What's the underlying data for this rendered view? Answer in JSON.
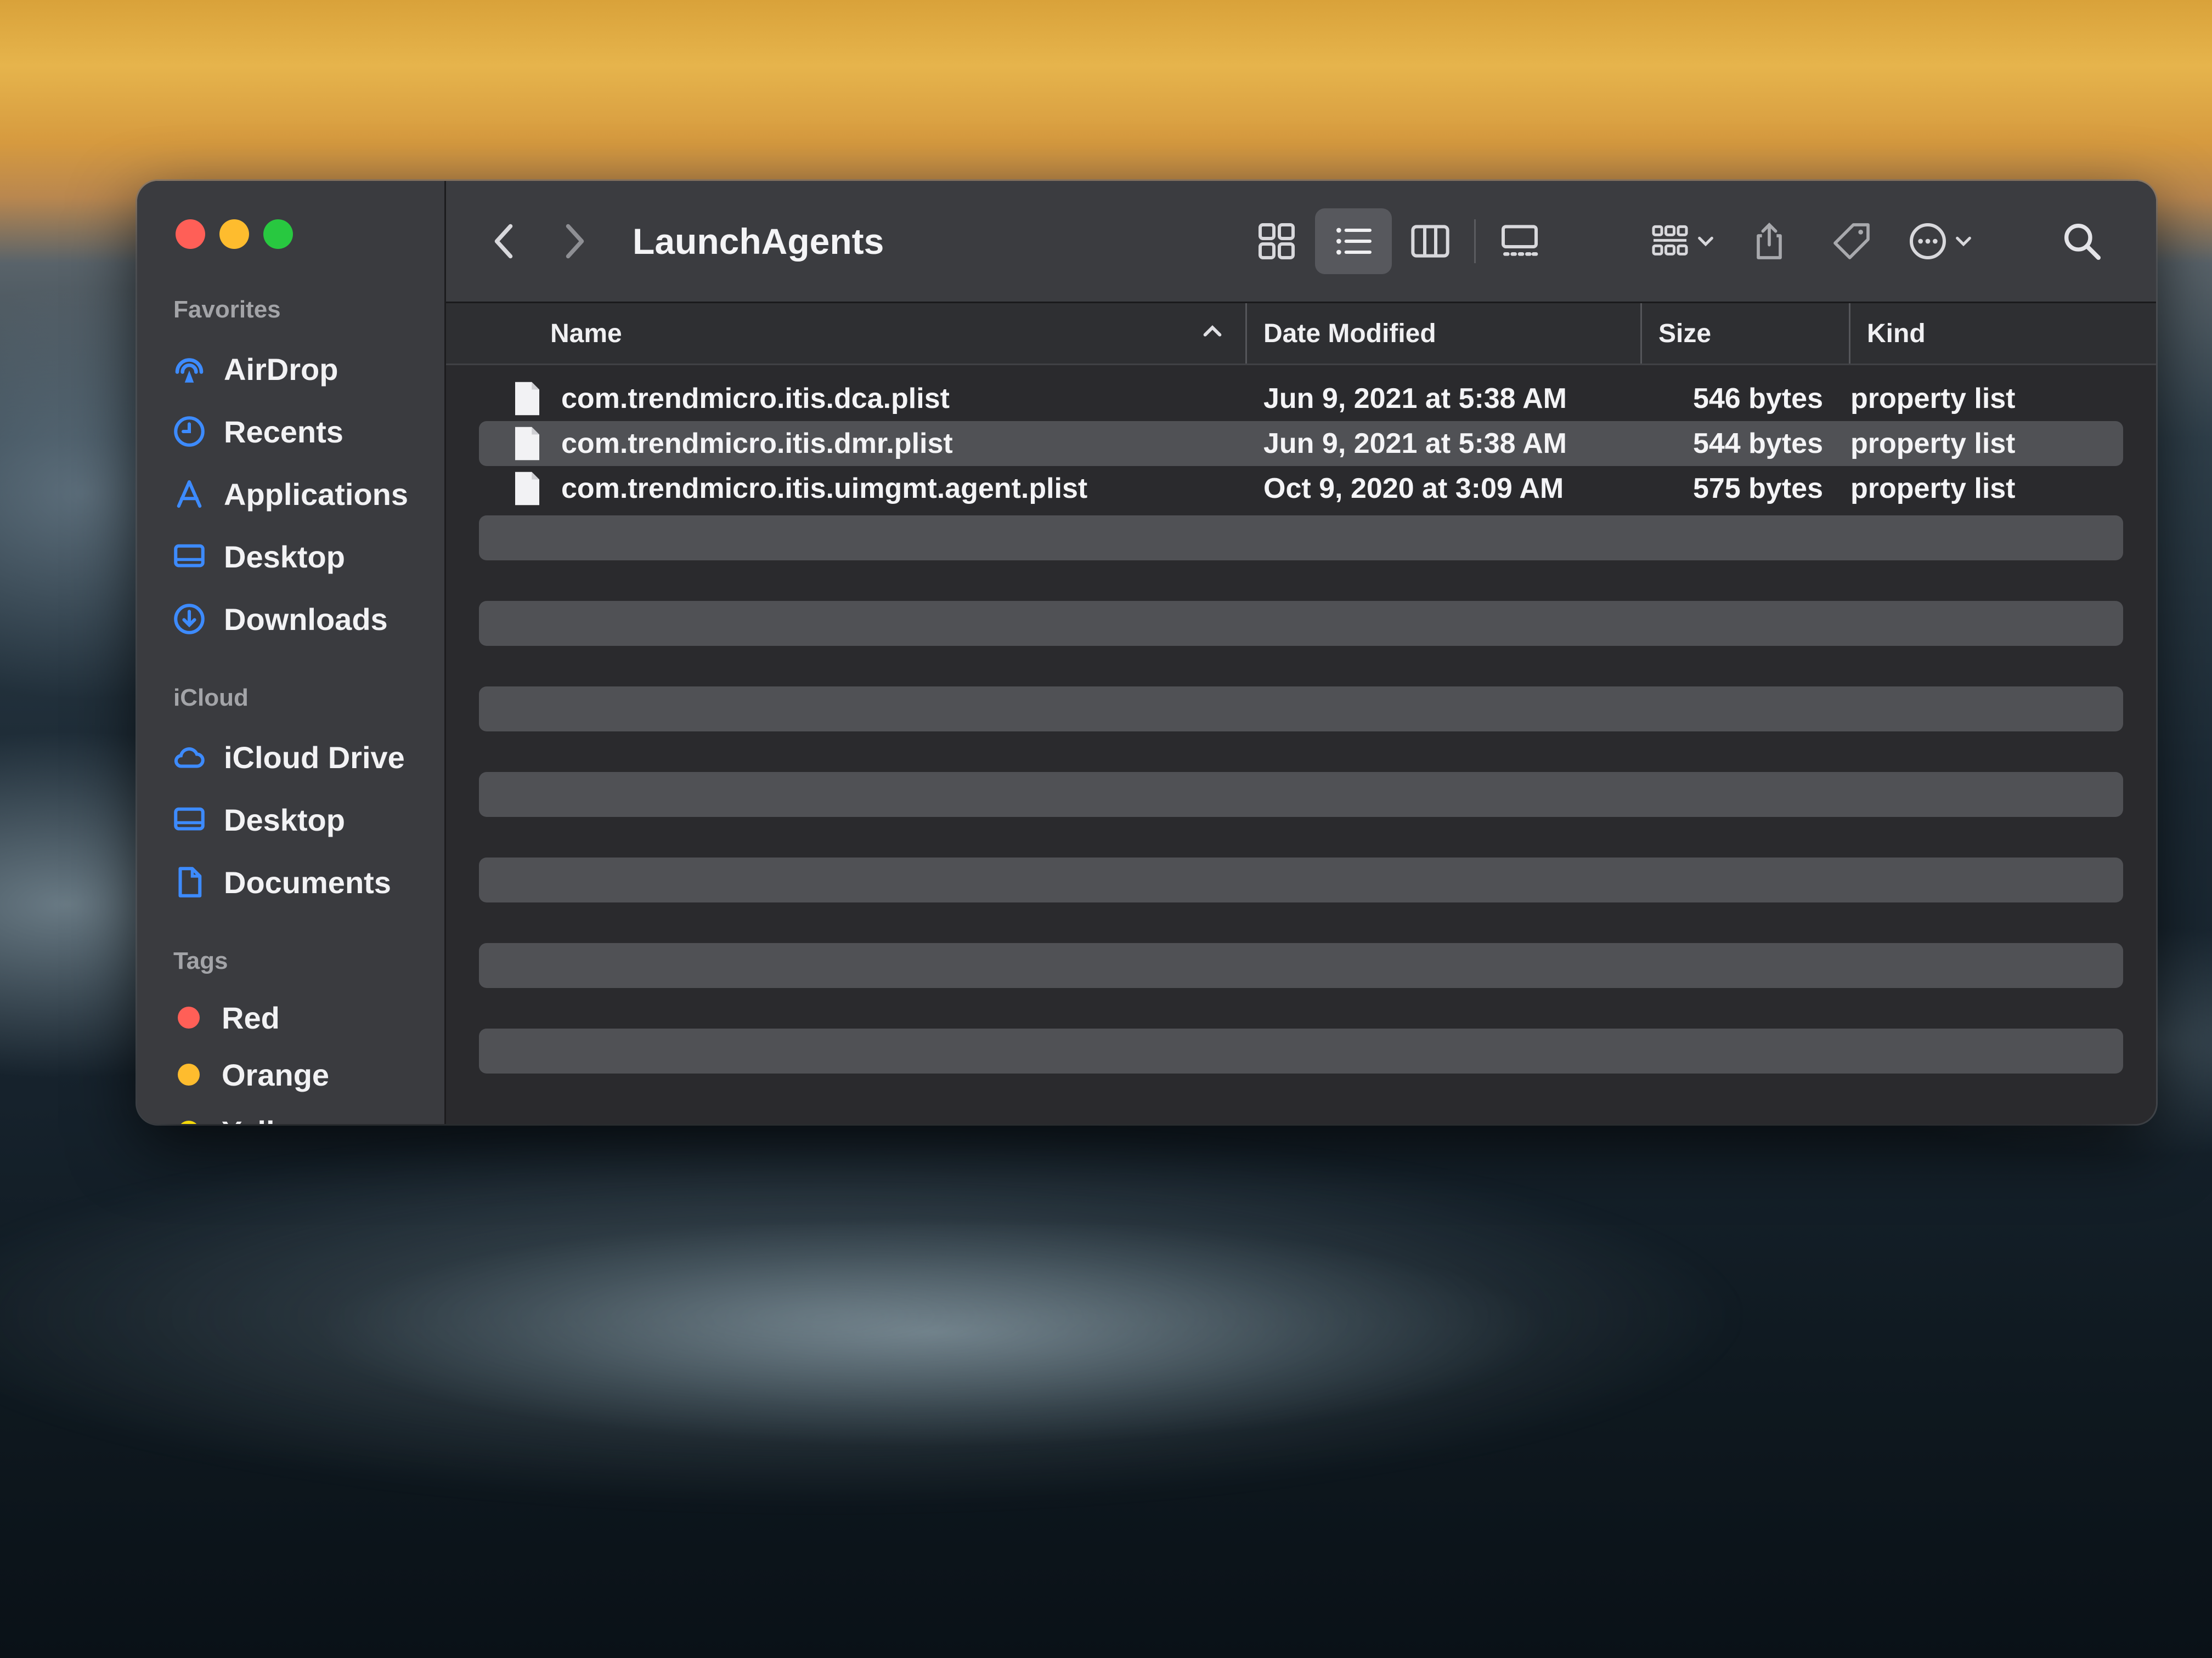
{
  "window": {
    "title": "LaunchAgents"
  },
  "sidebar": {
    "sections": [
      {
        "label": "Favorites",
        "items": [
          {
            "label": "AirDrop",
            "icon": "airdrop-icon"
          },
          {
            "label": "Recents",
            "icon": "clock-icon"
          },
          {
            "label": "Applications",
            "icon": "applications-icon"
          },
          {
            "label": "Desktop",
            "icon": "desktop-icon"
          },
          {
            "label": "Downloads",
            "icon": "download-icon"
          }
        ]
      },
      {
        "label": "iCloud",
        "items": [
          {
            "label": "iCloud Drive",
            "icon": "cloud-icon"
          },
          {
            "label": "Desktop",
            "icon": "desktop-icon"
          },
          {
            "label": "Documents",
            "icon": "document-icon"
          }
        ]
      },
      {
        "label": "Tags",
        "items": [
          {
            "label": "Red",
            "color": "#ff5f57"
          },
          {
            "label": "Orange",
            "color": "#febc2e"
          },
          {
            "label": "Yellow",
            "color": "#f5d90a"
          }
        ]
      }
    ]
  },
  "toolbar": {
    "active_view": "list",
    "icons": [
      "chevron-left-icon",
      "chevron-right-icon",
      "icon-view-icon",
      "list-view-icon",
      "column-view-icon",
      "gallery-view-icon",
      "group-icon",
      "share-icon",
      "tag-icon",
      "more-icon",
      "search-icon"
    ]
  },
  "columns": {
    "name": "Name",
    "date": "Date Modified",
    "size": "Size",
    "kind": "Kind"
  },
  "files": [
    {
      "name": "com.trendmicro.itis.dca.plist",
      "date": "Jun 9, 2021 at 5:38 AM",
      "size": "546 bytes",
      "kind": "property list"
    },
    {
      "name": "com.trendmicro.itis.dmr.plist",
      "date": "Jun 9, 2021 at 5:38 AM",
      "size": "544 bytes",
      "kind": "property list"
    },
    {
      "name": "com.trendmicro.itis.uimgmt.agent.plist",
      "date": "Oct 9, 2020 at 3:09 AM",
      "size": "575 bytes",
      "kind": "property list"
    }
  ],
  "colors": {
    "accent": "#3d8bff",
    "close": "#ff5f57",
    "minimize": "#febc2e",
    "maximize": "#28c840"
  }
}
